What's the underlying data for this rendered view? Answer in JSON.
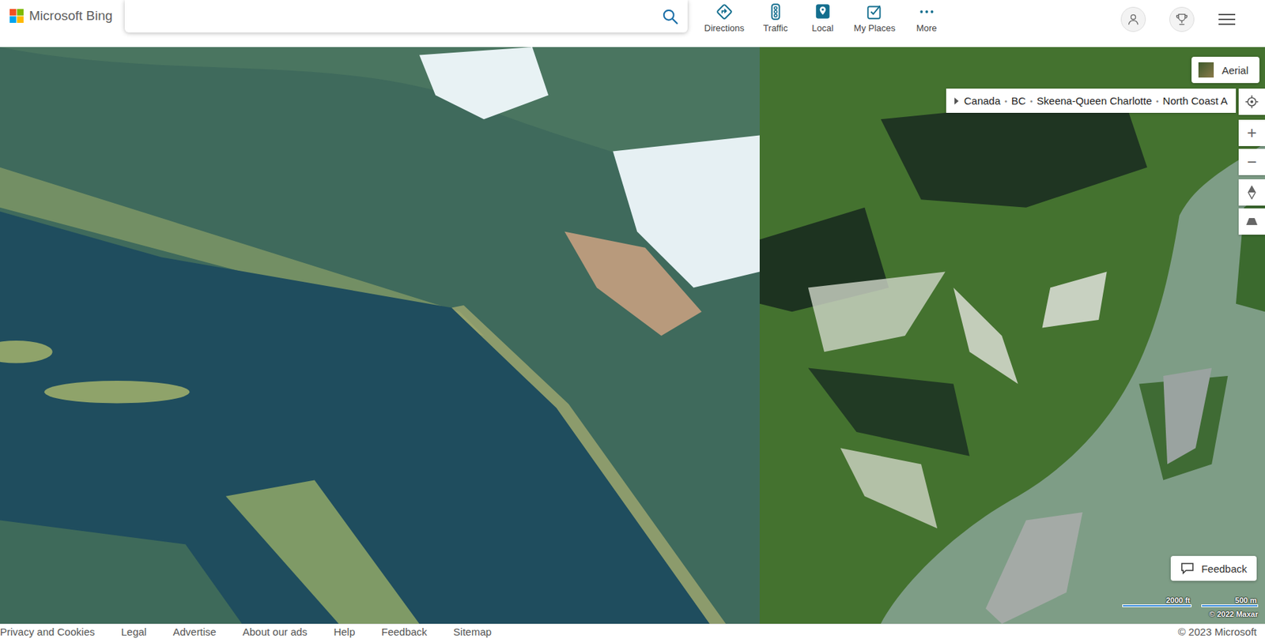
{
  "header": {
    "logo": "Microsoft Bing",
    "nav": [
      {
        "label": "Directions"
      },
      {
        "label": "Traffic"
      },
      {
        "label": "Local"
      },
      {
        "label": "My Places"
      },
      {
        "label": "More"
      }
    ]
  },
  "map": {
    "style_button": "Aerial",
    "breadcrumb": {
      "separator": "•",
      "items": [
        "Canada",
        "BC",
        "Skeena-Queen Charlotte",
        "North Coast A"
      ]
    },
    "zoom_in": "+",
    "zoom_out": "−",
    "feedback": "Feedback",
    "scale": [
      "2000 ft",
      "500 m"
    ],
    "copyright": "© 2022 Maxar"
  },
  "footer": {
    "links": [
      "Privacy and Cookies",
      "Legal",
      "Advertise",
      "About our ads",
      "Help",
      "Feedback",
      "Sitemap"
    ],
    "copyright": "© 2023 Microsoft"
  }
}
